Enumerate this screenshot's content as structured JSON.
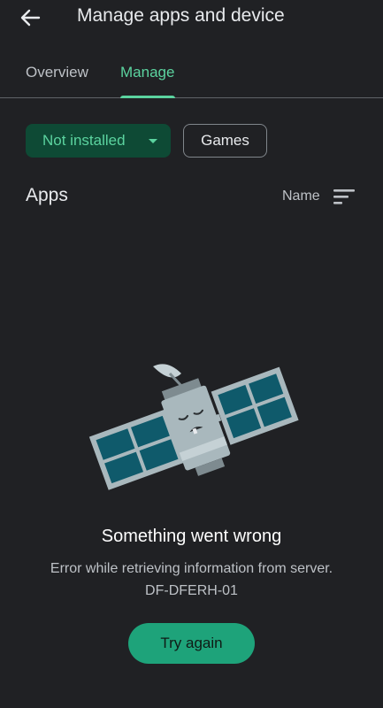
{
  "header": {
    "title": "Manage apps and device",
    "back_icon": "arrow-back-icon"
  },
  "tabs": [
    {
      "label": "Overview",
      "selected": false
    },
    {
      "label": "Manage",
      "selected": true
    }
  ],
  "filters": {
    "install_filter": {
      "label": "Not installed",
      "icon": "dropdown-caret-icon"
    },
    "games_chip": {
      "label": "Games"
    }
  },
  "apps_section": {
    "title": "Apps",
    "sort_label": "Name",
    "sort_icon": "sort-icon"
  },
  "error": {
    "illustration": "broken-satellite-icon",
    "title": "Something went wrong",
    "message": "Error while retrieving information from server.",
    "code": "DF-DFERH-01",
    "retry_label": "Try again"
  },
  "colors": {
    "background": "#202124",
    "accent": "#5bd39f",
    "chip_selected_bg": "#0e4a35",
    "button_bg": "#1ea37a",
    "satellite_panel": "#0f5a6b",
    "satellite_body": "#a9b8bd"
  }
}
